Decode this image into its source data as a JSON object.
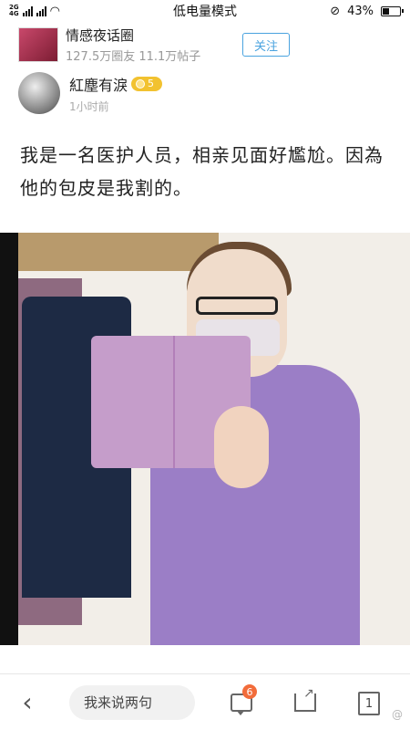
{
  "status_bar": {
    "network_top": "2G",
    "network_bottom": "4G",
    "mode": "低电量模式",
    "battery": "43%",
    "battery_level": 0.43
  },
  "group": {
    "name": "情感夜话圈",
    "stats": "127.5万圈友  11.1万帖子",
    "follow_label": "关注"
  },
  "author": {
    "name": "紅塵有淚",
    "level": "5",
    "time": "1小时前"
  },
  "post": {
    "text": "我是一名医护人员，相亲见面好尷尬。因為他的包皮是我割的。"
  },
  "bottom_bar": {
    "back_icon": "back-arrow-icon",
    "comment_placeholder": "我来说两句",
    "comment_count": "6",
    "page_label": "1"
  },
  "colors": {
    "accent_blue": "#4aa3df",
    "badge_gold": "#f2c230",
    "notify_orange": "#f26c3b"
  }
}
